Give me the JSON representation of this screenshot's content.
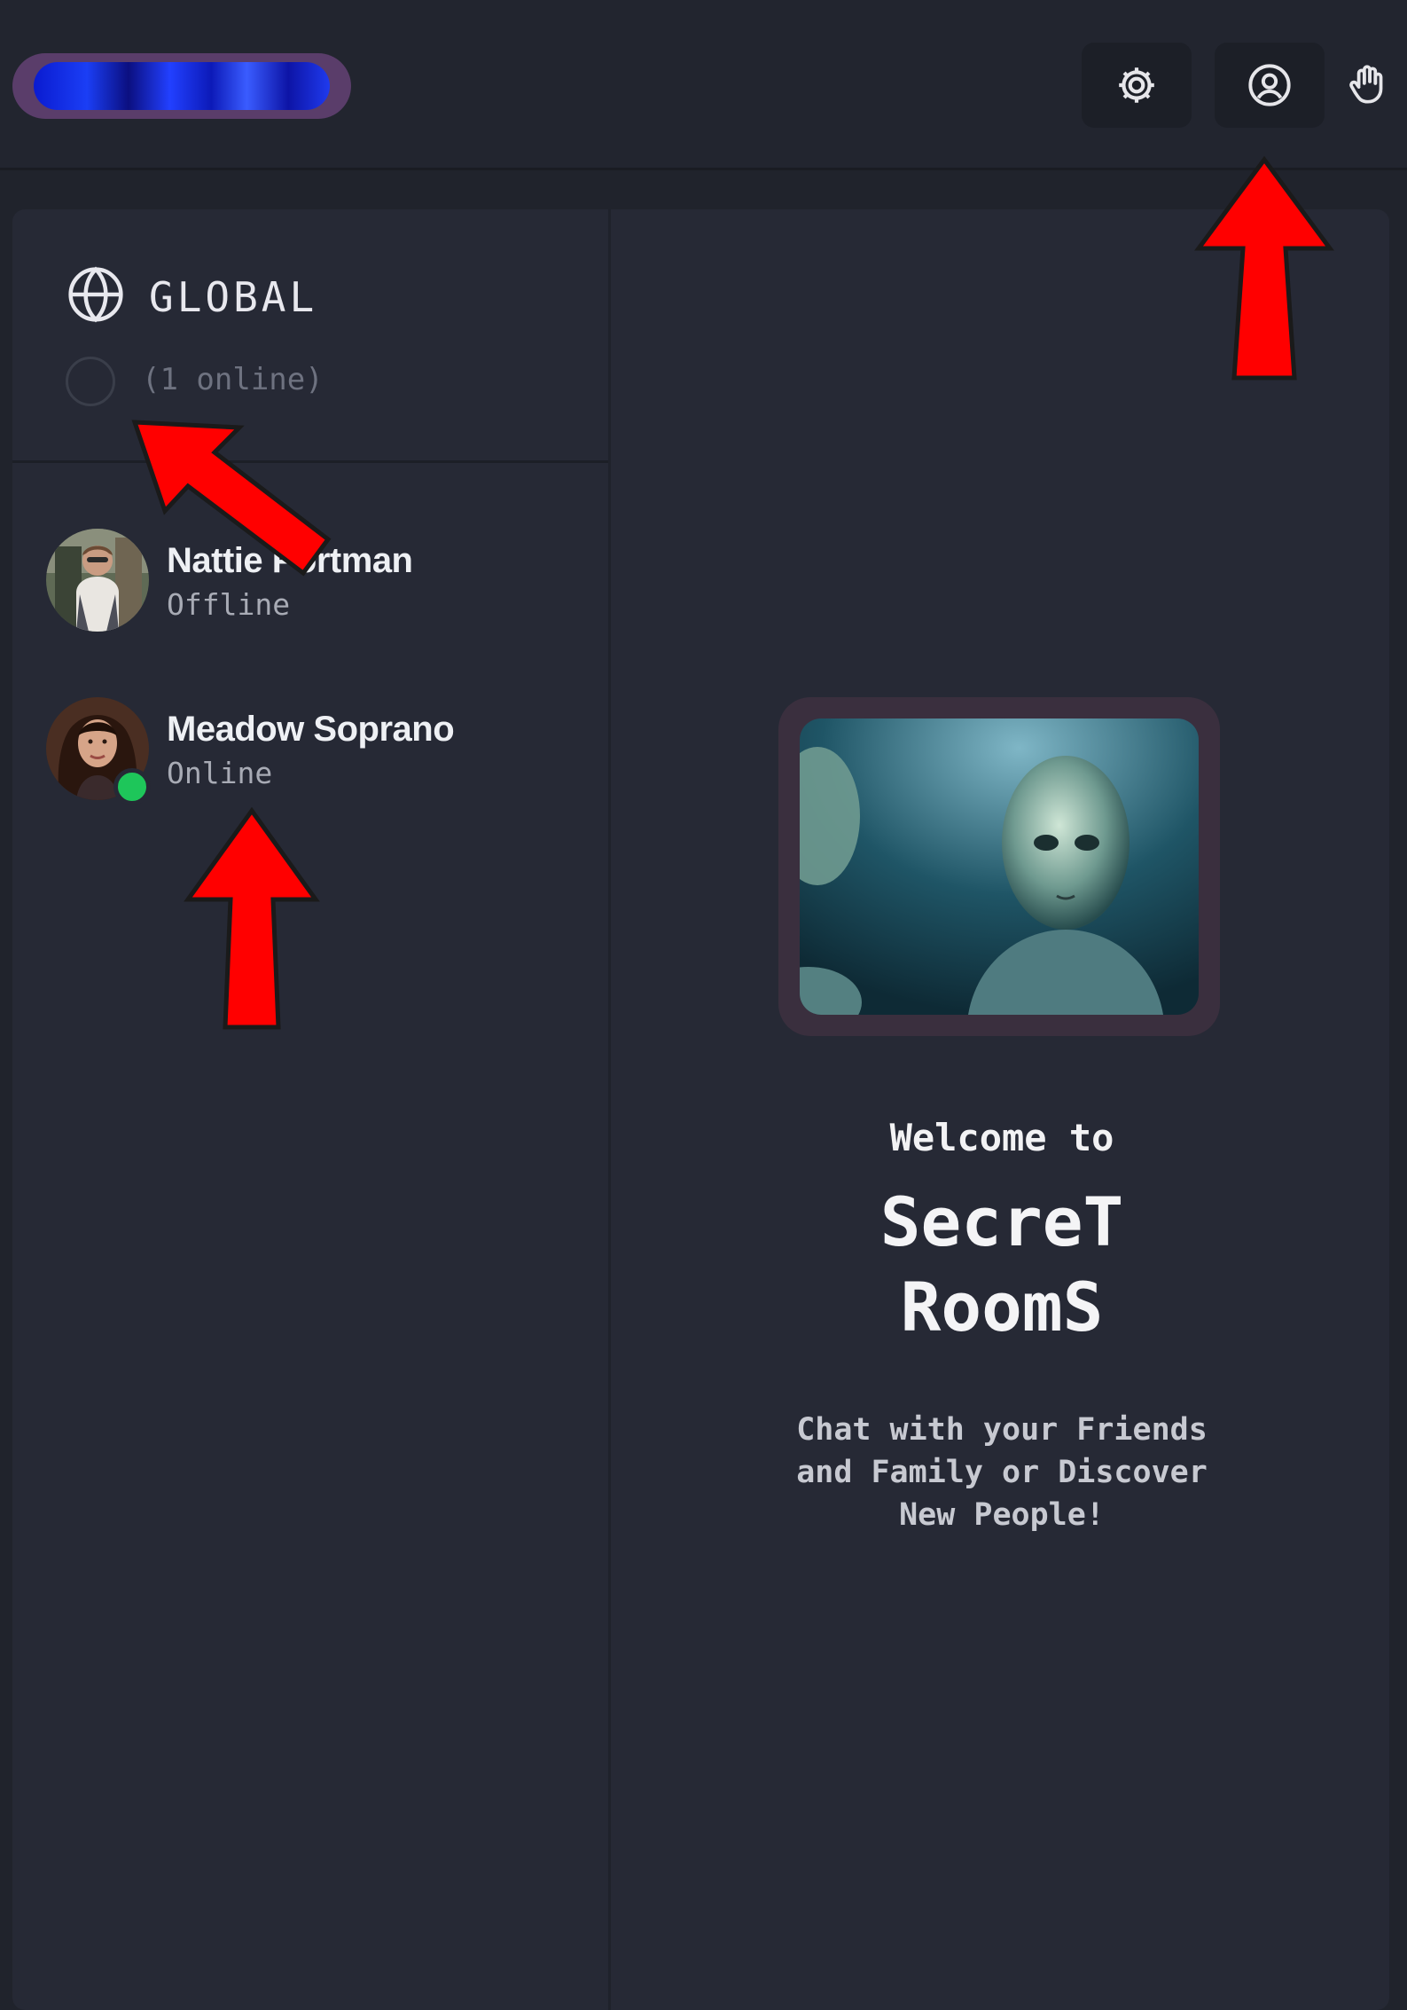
{
  "header": {
    "settings_icon": "gear-icon",
    "profile_icon": "user-circle-icon",
    "hand_icon": "hand-icon"
  },
  "sidebar": {
    "room_title": "GLOBAL",
    "online_count": "(1 online)",
    "contacts": [
      {
        "name": "Nattie Portman",
        "status": "Offline"
      },
      {
        "name": "Meadow Soprano",
        "status": "Online"
      }
    ]
  },
  "main": {
    "welcome": "Welcome to",
    "brand_line1": "SecreT",
    "brand_line2": "RoomS",
    "tagline_line1": "Chat with your Friends",
    "tagline_line2": "and Family or Discover",
    "tagline_line3": "New People!"
  },
  "colors": {
    "background": "#20232c",
    "panel": "#262935",
    "online_green": "#1ec65a",
    "annotation_red": "#ff0000"
  }
}
